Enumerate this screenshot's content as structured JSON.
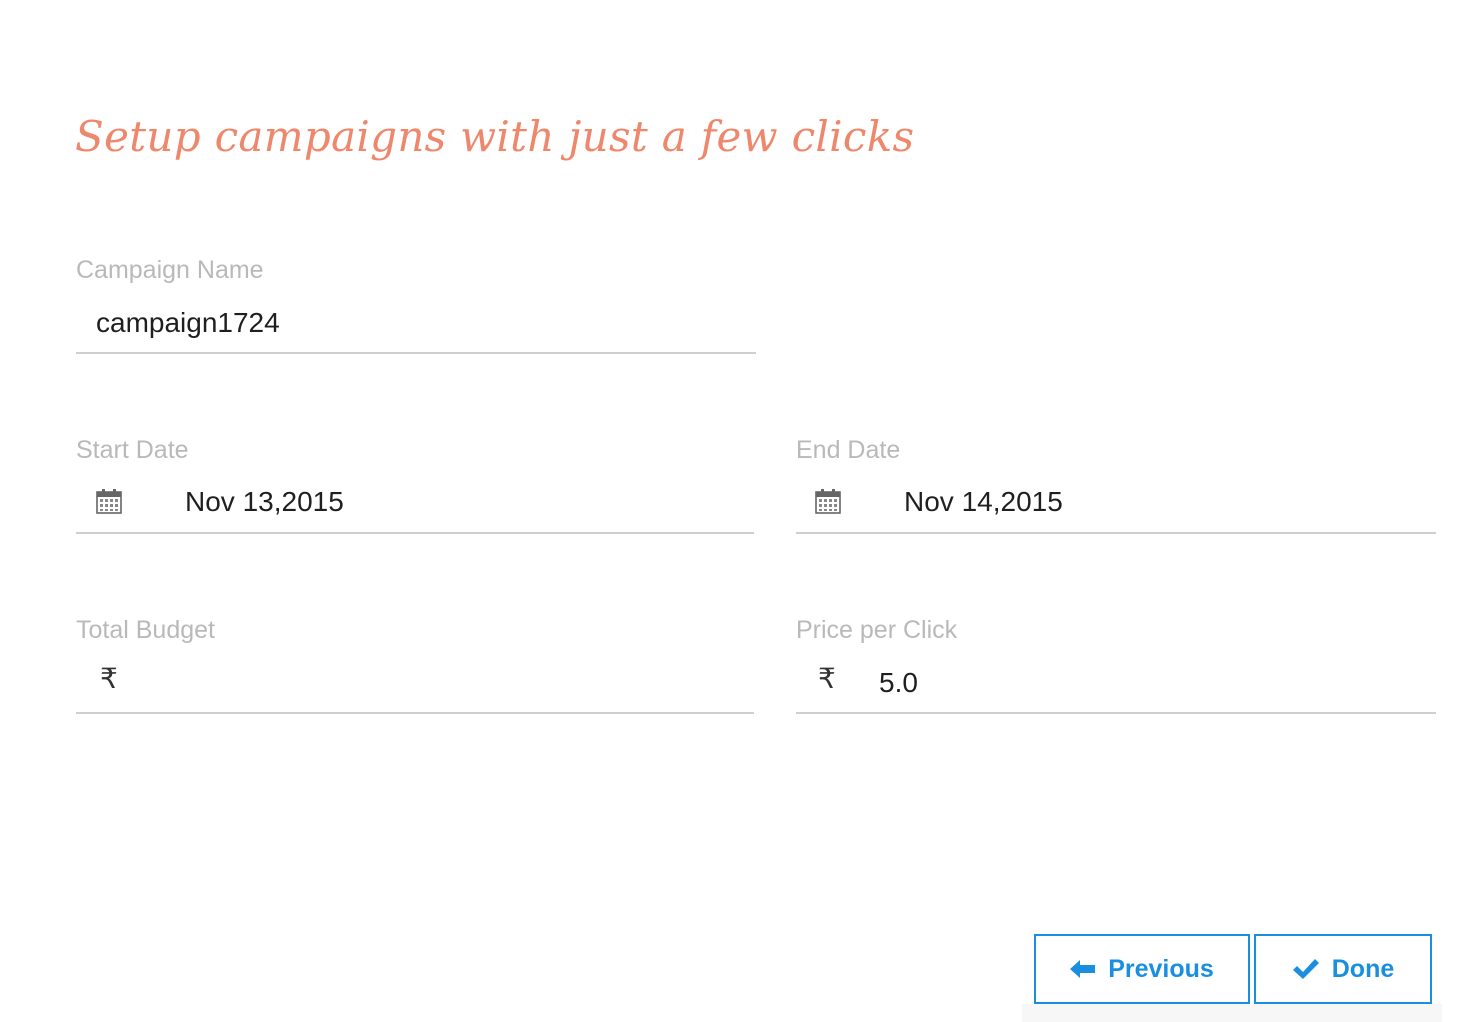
{
  "header": {
    "title": "Setup campaigns with just a few clicks"
  },
  "form": {
    "campaign_name": {
      "label": "Campaign Name",
      "value": "campaign1724"
    },
    "start_date": {
      "label": "Start Date",
      "value": "Nov 13,2015",
      "icon": "calendar-icon"
    },
    "end_date": {
      "label": "End Date",
      "value": "Nov 14,2015",
      "icon": "calendar-icon"
    },
    "total_budget": {
      "label": "Total Budget",
      "currency_symbol": "₹",
      "value": ""
    },
    "price_per_click": {
      "label": "Price per Click",
      "currency_symbol": "₹",
      "value": "5.0"
    }
  },
  "actions": {
    "previous_label": "Previous",
    "previous_icon": "arrow-left-icon",
    "done_label": "Done",
    "done_icon": "checkmark-icon"
  },
  "colors": {
    "title": "#ee876b",
    "label": "#b9b9b9",
    "accent": "#1a8fe0",
    "underline": "#cfcfcf"
  }
}
